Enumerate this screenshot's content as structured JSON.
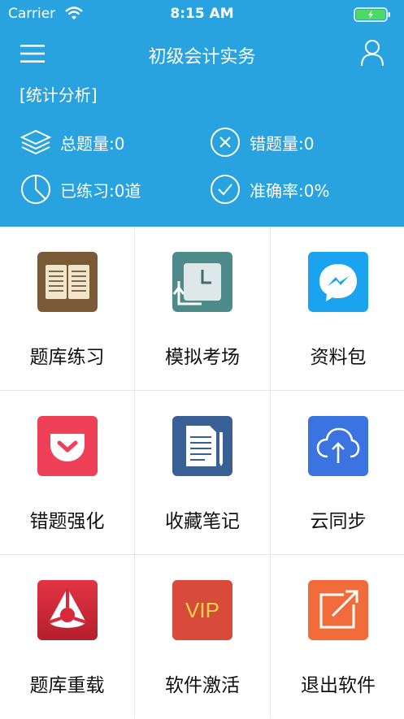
{
  "status_bar": {
    "carrier": "Carrier",
    "time": "8:15 AM"
  },
  "nav": {
    "title": "初级会计实务"
  },
  "stats": {
    "section_label": "[统计分析]",
    "total_questions": "总题量:0",
    "wrong_questions": "错题量:0",
    "practiced": "已练习:0道",
    "accuracy": "准确率:0%"
  },
  "menu": {
    "items": [
      {
        "label": "题库练习",
        "icon": "book-icon",
        "color": "#7a5a35"
      },
      {
        "label": "模拟考场",
        "icon": "clock-icon",
        "color": "#4f8a8b"
      },
      {
        "label": "资料包",
        "icon": "messenger-icon",
        "color": "#1aa3ee"
      },
      {
        "label": "错题强化",
        "icon": "pocket-icon",
        "color": "#ee4056"
      },
      {
        "label": "收藏笔记",
        "icon": "notes-icon",
        "color": "#3a5f95"
      },
      {
        "label": "云同步",
        "icon": "cloud-upload-icon",
        "color": "#3b73e0"
      },
      {
        "label": "题库重载",
        "icon": "reload-icon",
        "color": "#d8283a"
      },
      {
        "label": "软件激活",
        "icon": "vip-icon",
        "color": "#d84a3a",
        "text": "VIP"
      },
      {
        "label": "退出软件",
        "icon": "exit-icon",
        "color": "#f26b3a"
      }
    ]
  },
  "colors": {
    "header": "#29a3df"
  }
}
